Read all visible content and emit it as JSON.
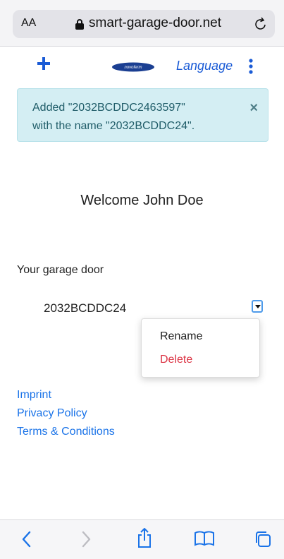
{
  "browser": {
    "text_size_label": "AA",
    "url": "smart-garage-door.net"
  },
  "appbar": {
    "add_icon": "plus-icon",
    "logo_text": "novoferm",
    "language_label": "Language",
    "menu_icon": "vertical-ellipsis-icon"
  },
  "alert": {
    "message_line1": "Added \"2032BCDDC2463597\"",
    "message_line2": "with the name \"2032BCDDC24\".",
    "close_glyph": "×"
  },
  "welcome": "Welcome John Doe",
  "doors": {
    "section_label": "Your garage door",
    "items": [
      {
        "name": "2032BCDDC24"
      }
    ],
    "menu": {
      "rename_label": "Rename",
      "delete_label": "Delete"
    }
  },
  "footer": {
    "links": [
      "Imprint",
      "Privacy Policy",
      "Terms & Conditions"
    ]
  },
  "colors": {
    "accent": "#1a5bd6",
    "link": "#1a73e8",
    "danger": "#dc3545",
    "alert_bg": "#d4eef3",
    "alert_text": "#1f5c68"
  }
}
